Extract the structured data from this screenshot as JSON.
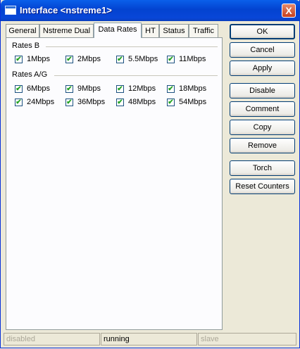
{
  "window": {
    "title": "Interface <nstreme1>",
    "close_label": "X"
  },
  "tabs": [
    {
      "label": "General"
    },
    {
      "label": "Nstreme Dual"
    },
    {
      "label": "Data Rates",
      "active": true
    },
    {
      "label": "HT"
    },
    {
      "label": "Status"
    },
    {
      "label": "Traffic"
    }
  ],
  "rates_b": {
    "title": "Rates B",
    "items": [
      {
        "label": "1Mbps",
        "checked": true
      },
      {
        "label": "2Mbps",
        "checked": true
      },
      {
        "label": "5.5Mbps",
        "checked": true
      },
      {
        "label": "11Mbps",
        "checked": true
      }
    ]
  },
  "rates_ag": {
    "title": "Rates A/G",
    "items": [
      {
        "label": "6Mbps",
        "checked": true
      },
      {
        "label": "9Mbps",
        "checked": true
      },
      {
        "label": "12Mbps",
        "checked": true
      },
      {
        "label": "18Mbps",
        "checked": true
      },
      {
        "label": "24Mbps",
        "checked": true
      },
      {
        "label": "36Mbps",
        "checked": true
      },
      {
        "label": "48Mbps",
        "checked": true
      },
      {
        "label": "54Mbps",
        "checked": true
      }
    ]
  },
  "buttons": {
    "ok": "OK",
    "cancel": "Cancel",
    "apply": "Apply",
    "disable": "Disable",
    "comment": "Comment",
    "copy": "Copy",
    "remove": "Remove",
    "torch": "Torch",
    "reset_counters": "Reset Counters"
  },
  "status": {
    "left": "disabled",
    "middle": "running",
    "right": "slave"
  },
  "check_glyph": "✔"
}
